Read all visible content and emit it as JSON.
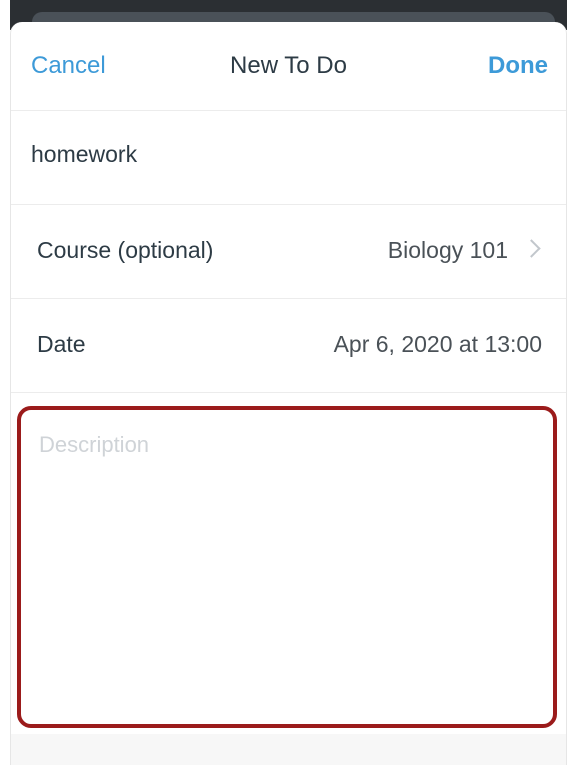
{
  "navbar": {
    "cancel_label": "Cancel",
    "title": "New To Do",
    "done_label": "Done"
  },
  "form": {
    "title_value": "homework",
    "course": {
      "label": "Course (optional)",
      "value": "Biology 101"
    },
    "date": {
      "label": "Date",
      "value": "Apr 6, 2020 at 13:00"
    },
    "description": {
      "placeholder": "Description"
    }
  },
  "colors": {
    "accent": "#3d9ad8",
    "highlight_border": "#9b1b1b",
    "text": "#2d3b45"
  }
}
